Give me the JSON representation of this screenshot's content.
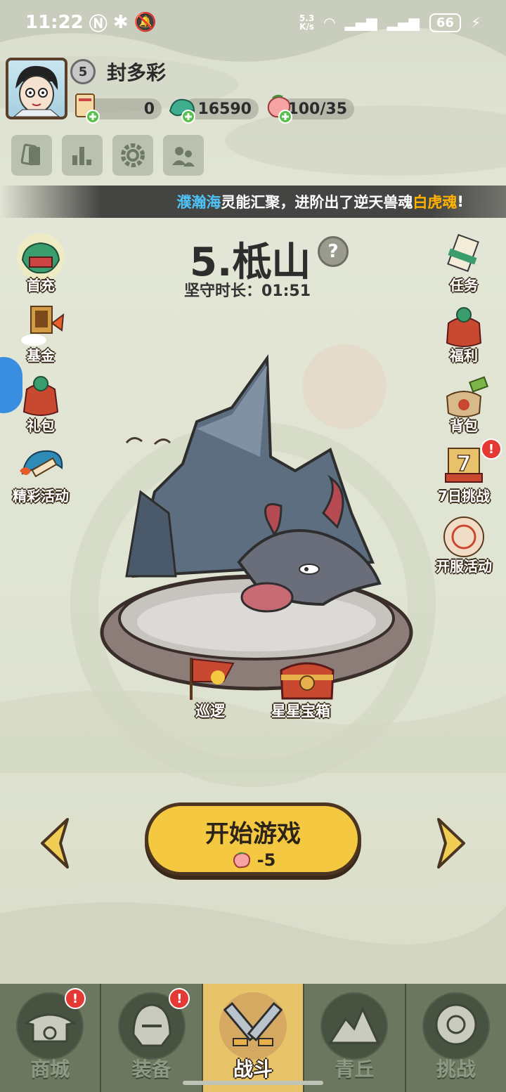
{
  "status_bar": {
    "time": "11:22",
    "net_speed_top": "5.3",
    "net_speed_bottom": "K/s",
    "battery": "66"
  },
  "player": {
    "level": "5",
    "name": "封多彩"
  },
  "resources": [
    {
      "name": "ticket",
      "value": "0"
    },
    {
      "name": "jade",
      "value": "16590"
    },
    {
      "name": "stamina",
      "value": "100/35"
    }
  ],
  "marquee": {
    "place": "濮瀚海",
    "middle": " 灵能汇聚，进阶出了逆天兽魂 ",
    "beast": "白虎魂",
    "end": "!"
  },
  "stage": {
    "title": "5.柢山",
    "help": "?",
    "hold_label": "坚守时长：",
    "hold_time": "01:51"
  },
  "left_menu": [
    {
      "label": "首充"
    },
    {
      "label": "基金"
    },
    {
      "label": "礼包"
    },
    {
      "label": "精彩活动"
    }
  ],
  "right_menu": [
    {
      "label": "任务"
    },
    {
      "label": "福利"
    },
    {
      "label": "背包"
    },
    {
      "label": "7日挑战",
      "badge": "!"
    },
    {
      "label": "开服活动"
    }
  ],
  "map_labels": {
    "patrol": "巡逻",
    "star_chest": "星星宝箱"
  },
  "start": {
    "label": "开始游戏",
    "cost": "-5"
  },
  "nav": [
    {
      "label": "商城",
      "badge": "!"
    },
    {
      "label": "装备",
      "badge": "!"
    },
    {
      "label": "战斗",
      "active": true
    },
    {
      "label": "青丘"
    },
    {
      "label": "挑战"
    }
  ],
  "colors": {
    "accent_yellow": "#f5c842",
    "nav_bg": "#6b775f",
    "badge_red": "#e53935",
    "marquee_blue": "#4fc3f7",
    "marquee_gold": "#ffb300"
  }
}
